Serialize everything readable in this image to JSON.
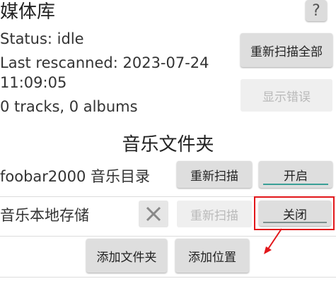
{
  "header": {
    "title": "媒体库",
    "help_glyph": "?"
  },
  "status": {
    "status_line": "Status: idle",
    "rescan_line1": "Last rescanned: 2023-07-24",
    "rescan_line2": "11:09:05",
    "counts": "0 tracks, 0 albums"
  },
  "actions": {
    "rescan_all": "重新扫描全部",
    "show_errors": "显示错误"
  },
  "section_title": "音乐文件夹",
  "folders": [
    {
      "label": "foobar2000 音乐目录",
      "rescan": "重新扫描",
      "toggle": "开启"
    },
    {
      "label": "音乐本地存储",
      "rescan": "重新扫描",
      "toggle": "关闭"
    }
  ],
  "bottom": {
    "add_folder": "添加文件夹",
    "add_location": "添加位置"
  },
  "colors": {
    "annotation": "#e2161a",
    "toggle_on_bar": "#3a9f96"
  }
}
